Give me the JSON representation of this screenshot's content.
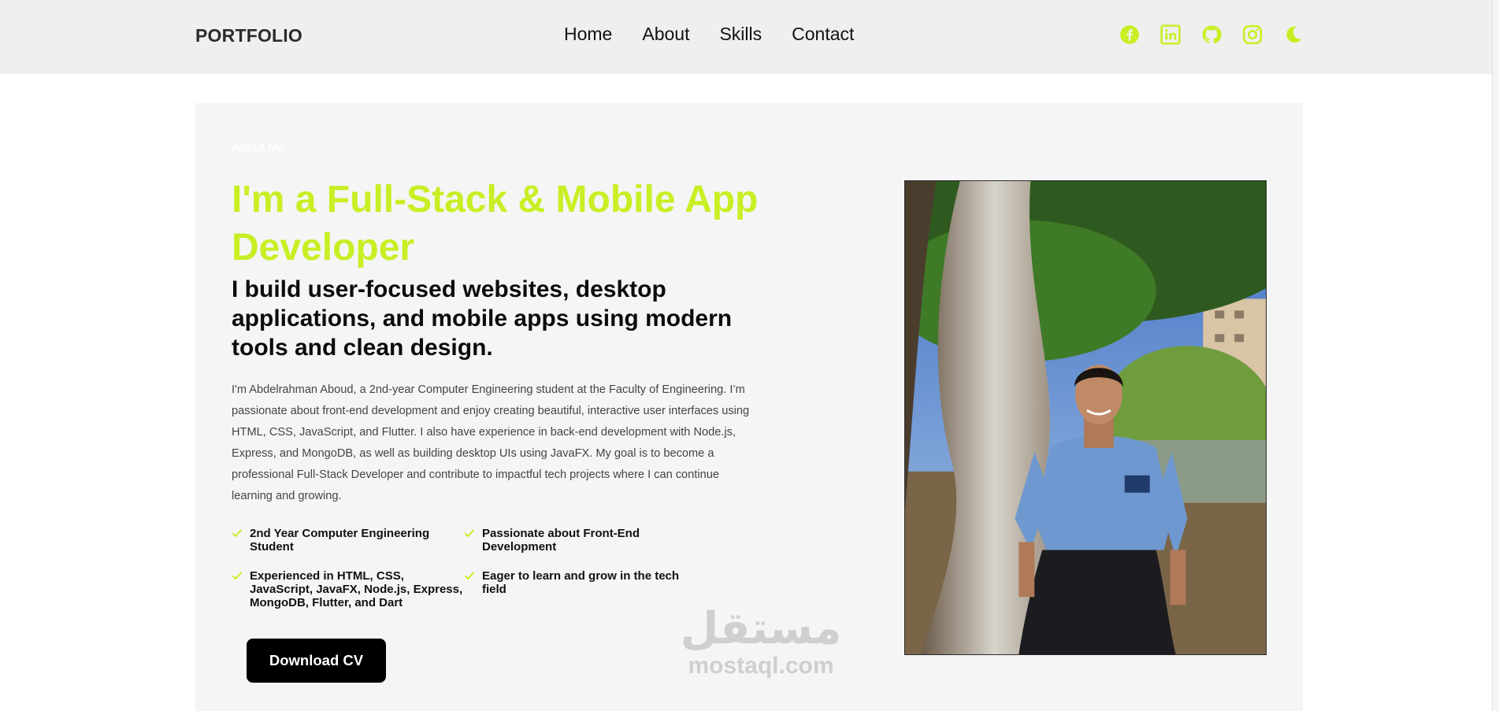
{
  "header": {
    "logo": "PORTFOLIO",
    "nav": [
      {
        "label": "Home"
      },
      {
        "label": "About"
      },
      {
        "label": "Skills"
      },
      {
        "label": "Contact"
      }
    ],
    "social_icons": [
      "facebook-icon",
      "linkedin-icon",
      "github-icon",
      "instagram-icon",
      "moon-icon"
    ]
  },
  "about": {
    "eyebrow": "About Me",
    "headline": "I'm a Full-Stack & Mobile App Developer",
    "subhead": "I build user-focused websites, desktop applications, and mobile apps using modern tools and clean design.",
    "bio": "I'm Abdelrahman Aboud, a 2nd-year Computer Engineering student at the Faculty of Engineering. I’m passionate about front-end development and enjoy creating beautiful, interactive user interfaces using HTML, CSS, JavaScript, and Flutter. I also have experience in back-end development with Node.js, Express, and MongoDB, as well as building desktop UIs using JavaFX. My goal is to become a professional Full-Stack Developer and contribute to impactful tech projects where I can continue learning and growing.",
    "features": [
      {
        "text": "2nd Year Computer Engineering Student"
      },
      {
        "text": "Passionate about Front-End Development"
      },
      {
        "text": "Experienced in HTML, CSS, JavaScript, JavaFX, Node.js, Express, MongoDB, Flutter, and Dart"
      },
      {
        "text": "Eager to learn and grow in the tech field"
      }
    ],
    "cv_button": "Download CV"
  },
  "watermark": {
    "arabic": "مستقل",
    "latin": "mostaql.com"
  },
  "colors": {
    "accent": "#c8ef24",
    "header_bg": "#efefef",
    "card_bg": "#f5f5f5",
    "button_bg": "#000000"
  }
}
